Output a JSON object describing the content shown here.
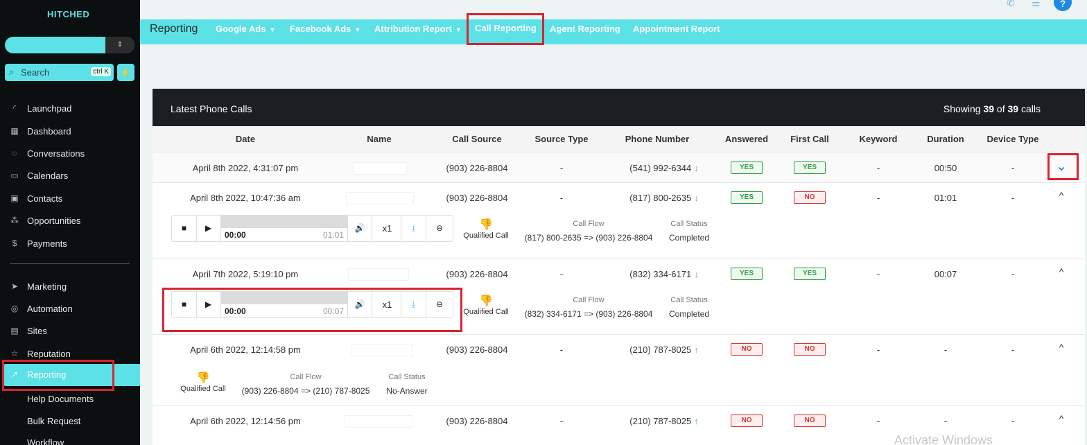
{
  "sidebar": {
    "brand": "HITCHED",
    "search_placeholder": "Search",
    "search_shortcut": "ctrl K",
    "items": [
      {
        "label": "Launchpad"
      },
      {
        "label": "Dashboard"
      },
      {
        "label": "Conversations"
      },
      {
        "label": "Calendars"
      },
      {
        "label": "Contacts"
      },
      {
        "label": "Opportunities"
      },
      {
        "label": "Payments"
      },
      {
        "label": "Marketing"
      },
      {
        "label": "Automation"
      },
      {
        "label": "Sites"
      },
      {
        "label": "Reputation"
      },
      {
        "label": "Reporting"
      },
      {
        "label": "Help Documents"
      },
      {
        "label": "Bulk Request"
      },
      {
        "label": "Workflow"
      }
    ]
  },
  "topnav": {
    "title": "Reporting",
    "tabs": [
      {
        "label": "Google Ads"
      },
      {
        "label": "Facebook Ads"
      },
      {
        "label": "Attribution Report"
      },
      {
        "label": "Call Reporting"
      },
      {
        "label": "Agent Reporting"
      },
      {
        "label": "Appointment Report"
      }
    ]
  },
  "card": {
    "title": "Latest Phone Calls",
    "showing_prefix": "Showing ",
    "showing_count": "39",
    "showing_of": " of ",
    "showing_total": "39",
    "showing_suffix": " calls"
  },
  "columns": [
    "Date",
    "Name",
    "Call Source",
    "Source Type",
    "Phone Number",
    "Answered",
    "First Call",
    "Keyword",
    "Duration",
    "Device Type"
  ],
  "rows": [
    {
      "date": "April 8th 2022, 4:31:07 pm",
      "source": "(903) 226-8804",
      "source_type": "-",
      "phone": "(541) 992-6344",
      "direction": "↓",
      "answered": "YES",
      "first_call": "YES",
      "keyword": "-",
      "duration": "00:50",
      "device": "-",
      "toggle": "⌄"
    },
    {
      "date": "April 8th 2022, 10:47:36 am",
      "source": "(903) 226-8804",
      "source_type": "-",
      "phone": "(817) 800-2635",
      "direction": "↓",
      "answered": "YES",
      "first_call": "NO",
      "keyword": "-",
      "duration": "01:01",
      "device": "-",
      "toggle": "^",
      "player": {
        "current": "00:00",
        "total": "01:01",
        "speed": "x1"
      },
      "qualified": "Qualified Call",
      "flow_label": "Call Flow",
      "flow": "(817) 800-2635 => (903) 226-8804",
      "status_label": "Call Status",
      "status": "Completed"
    },
    {
      "date": "April 7th 2022, 5:19:10 pm",
      "source": "(903) 226-8804",
      "source_type": "-",
      "phone": "(832) 334-6171",
      "direction": "↓",
      "answered": "YES",
      "first_call": "YES",
      "keyword": "-",
      "duration": "00:07",
      "device": "-",
      "toggle": "^",
      "player": {
        "current": "00:00",
        "total": "00:07",
        "speed": "x1"
      },
      "qualified": "Qualified Call",
      "flow_label": "Call Flow",
      "flow": "(832) 334-6171 => (903) 226-8804",
      "status_label": "Call Status",
      "status": "Completed"
    },
    {
      "date": "April 6th 2022, 12:14:58 pm",
      "source": "(903) 226-8804",
      "source_type": "-",
      "phone": "(210) 787-8025",
      "direction": "↑",
      "answered": "NO",
      "first_call": "NO",
      "keyword": "-",
      "duration": "-",
      "device": "-",
      "toggle": "^",
      "qualified": "Qualified Call",
      "flow_label": "Call Flow",
      "flow": "(903) 226-8804 => (210) 787-8025",
      "status_label": "Call Status",
      "status": "No-Answer"
    },
    {
      "date": "April 6th 2022, 12:14:56 pm",
      "source": "(903) 226-8804",
      "source_type": "-",
      "phone": "(210) 787-8025",
      "direction": "↑",
      "answered": "NO",
      "first_call": "NO",
      "keyword": "-",
      "duration": "-",
      "device": "-",
      "toggle": "^"
    }
  ],
  "watermark": "Activate Windows",
  "colors": {
    "accent": "#5ce1e6",
    "sidebar_bg": "#0b0f0f",
    "highlight": "#d9232f",
    "yes": "#2e9a42",
    "no": "#dd3333"
  }
}
